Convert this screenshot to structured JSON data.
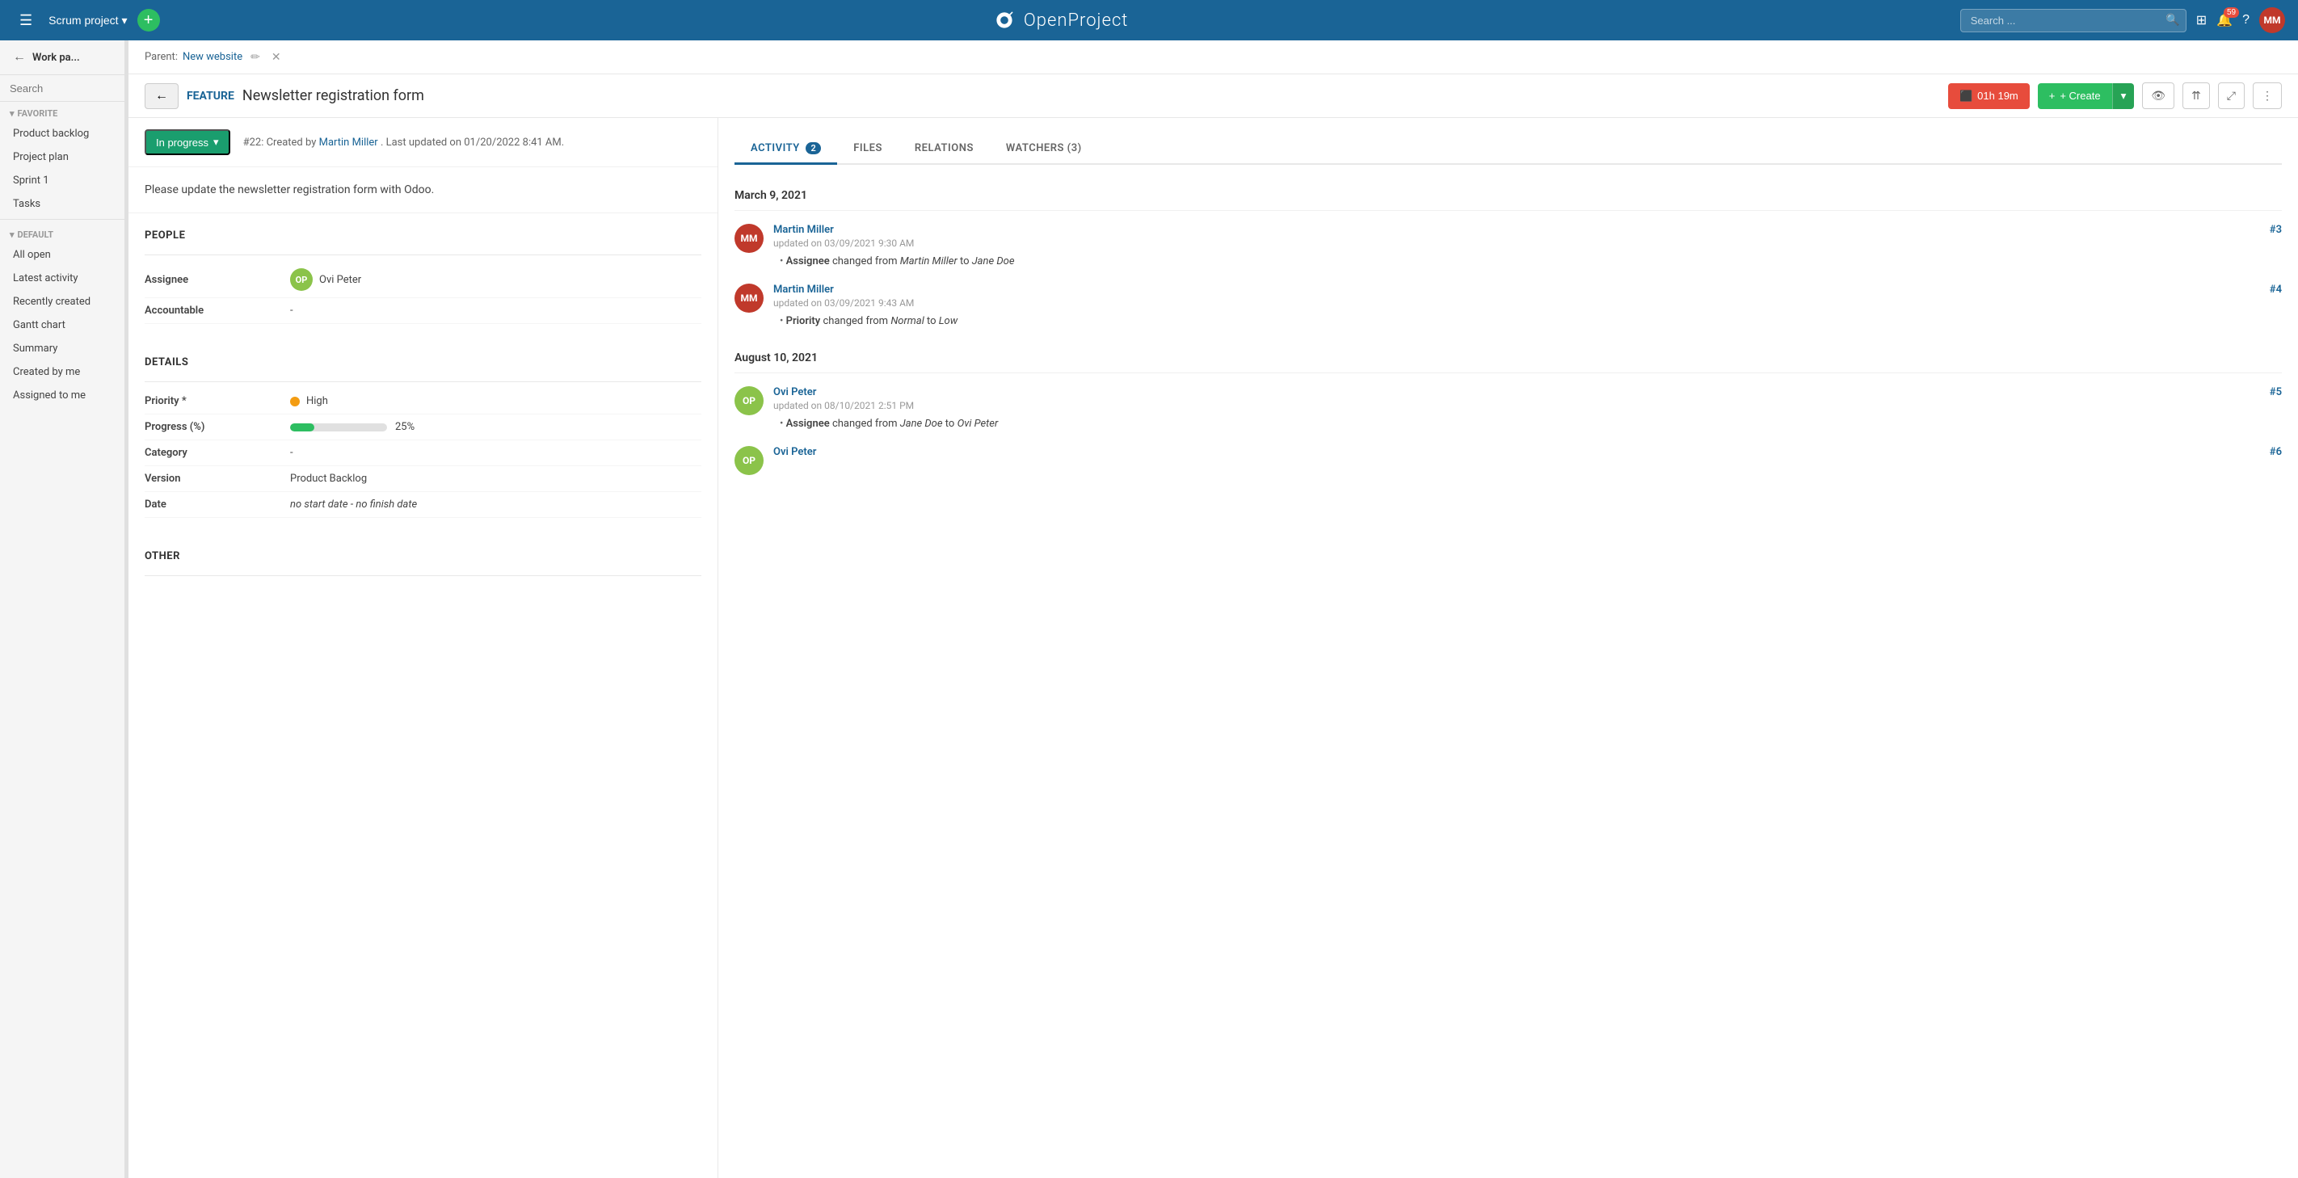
{
  "topNav": {
    "hamburger_label": "☰",
    "project_name": "Scrum project",
    "project_dropdown": "▾",
    "add_tooltip": "+",
    "logo_text": "OpenProject",
    "search_placeholder": "Search ...",
    "notifications_count": "59",
    "help_label": "?",
    "avatar_initials": "MM",
    "avatar_bg": "#c0392b"
  },
  "sidebar": {
    "back_label": "←",
    "title": "Work pa...",
    "search_placeholder": "Search",
    "search_icon": "🔍",
    "sections": {
      "favorite": {
        "label": "FAVORITE",
        "items": [
          {
            "id": "product-backlog",
            "label": "Product backlog",
            "active": false
          },
          {
            "id": "project-plan",
            "label": "Project plan",
            "active": false
          },
          {
            "id": "sprint-1",
            "label": "Sprint 1",
            "active": false
          },
          {
            "id": "tasks",
            "label": "Tasks",
            "active": false
          }
        ]
      },
      "default": {
        "label": "DEFAULT",
        "items": [
          {
            "id": "all-open",
            "label": "All open",
            "active": false
          },
          {
            "id": "latest-activity",
            "label": "Latest activity",
            "active": false
          },
          {
            "id": "recently-created",
            "label": "Recently created",
            "active": false
          },
          {
            "id": "gantt-chart",
            "label": "Gantt chart",
            "active": false
          },
          {
            "id": "summary",
            "label": "Summary",
            "active": false
          },
          {
            "id": "created-by-me",
            "label": "Created by me",
            "active": false
          },
          {
            "id": "assigned-to-me",
            "label": "Assigned to me",
            "active": false
          }
        ]
      }
    }
  },
  "breadcrumb": {
    "parent_label": "Parent:",
    "link_text": "New website",
    "edit_icon": "✏",
    "close_icon": "✕"
  },
  "toolbar": {
    "back_icon": "←",
    "feature_label": "FEATURE",
    "work_title": "Newsletter registration form",
    "time_icon": "⬛",
    "time_label": "01h 19m",
    "create_label": "+ Create",
    "create_dropdown": "▾",
    "watch_icon": "👁",
    "share_icon": "⇈",
    "fullscreen_icon": "⤢",
    "more_icon": "⋮"
  },
  "status": {
    "label": "In progress",
    "dropdown_icon": "▾",
    "info_text": "#22: Created by",
    "created_by": "Martin Miller",
    "updated_text": ". Last updated on 01/20/2022 8:41 AM."
  },
  "description": {
    "text": "Please update the newsletter registration form with Odoo."
  },
  "people": {
    "section_title": "PEOPLE",
    "assignee_label": "Assignee",
    "assignee_initials": "OP",
    "assignee_name": "Ovi Peter",
    "assignee_bg": "#8bc34a",
    "accountable_label": "Accountable",
    "accountable_value": "-"
  },
  "details": {
    "section_title": "DETAILS",
    "priority_label": "Priority *",
    "priority_dot_color": "#f39c12",
    "priority_value": "High",
    "progress_label": "Progress (%)",
    "progress_value": 25,
    "progress_text": "25%",
    "category_label": "Category",
    "category_value": "-",
    "version_label": "Version",
    "version_value": "Product Backlog",
    "date_label": "Date",
    "date_value": "no start date - no finish date"
  },
  "other": {
    "section_title": "OTHER"
  },
  "tabs": [
    {
      "id": "activity",
      "label": "ACTIVITY",
      "badge": "2",
      "active": true
    },
    {
      "id": "files",
      "label": "FILES",
      "badge": null,
      "active": false
    },
    {
      "id": "relations",
      "label": "RELATIONS",
      "badge": null,
      "active": false
    },
    {
      "id": "watchers",
      "label": "WATCHERS (3)",
      "badge": null,
      "active": false
    }
  ],
  "activity": {
    "groups": [
      {
        "date": "March 9, 2021",
        "items": [
          {
            "id": 3,
            "num": "#3",
            "avatar_initials": "MM",
            "avatar_bg": "#c0392b",
            "author": "Martin Miller",
            "time": "updated on 03/09/2021 9:30 AM",
            "change_field": "Assignee",
            "change_from": "Martin Miller",
            "change_to": "Jane Doe"
          },
          {
            "id": 4,
            "num": "#4",
            "avatar_initials": "MM",
            "avatar_bg": "#c0392b",
            "author": "Martin Miller",
            "time": "updated on 03/09/2021 9:43 AM",
            "change_field": "Priority",
            "change_from": "Normal",
            "change_to": "Low"
          }
        ]
      },
      {
        "date": "August 10, 2021",
        "items": [
          {
            "id": 5,
            "num": "#5",
            "avatar_initials": "OP",
            "avatar_bg": "#8bc34a",
            "author": "Ovi Peter",
            "time": "updated on 08/10/2021 2:51 PM",
            "change_field": "Assignee",
            "change_from": "Jane Doe",
            "change_to": "Ovi Peter"
          },
          {
            "id": 6,
            "num": "#6",
            "avatar_initials": "OP",
            "avatar_bg": "#8bc34a",
            "author": "Ovi Peter",
            "time": "",
            "change_field": "",
            "change_from": "",
            "change_to": ""
          }
        ]
      }
    ]
  }
}
